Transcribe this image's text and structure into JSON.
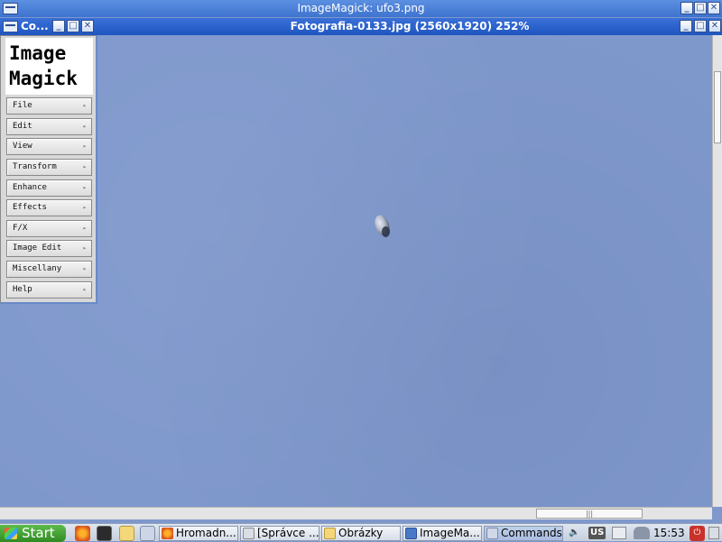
{
  "outer_window": {
    "title": "ImageMagick: ufo3.png",
    "min": "_",
    "max": "□",
    "close": "✕"
  },
  "viewer_window": {
    "title": "Fotografia-0133.jpg (2560x1920) 252%",
    "min": "_",
    "max": "□",
    "close": "✕"
  },
  "commands_window": {
    "title": "Co...",
    "logo_line1": "Image",
    "logo_line2": "Magick",
    "menu": [
      {
        "label": "File"
      },
      {
        "label": "Edit"
      },
      {
        "label": "View"
      },
      {
        "label": "Transform"
      },
      {
        "label": "Enhance"
      },
      {
        "label": "Effects"
      },
      {
        "label": "F/X"
      },
      {
        "label": "Image Edit"
      },
      {
        "label": "Miscellany"
      },
      {
        "label": "Help"
      }
    ],
    "arrow": "▸"
  },
  "taskbar": {
    "start_label": "Start",
    "tasks": [
      {
        "label": "Hromadn..."
      },
      {
        "label": "[Správce ..."
      },
      {
        "label": "Obrázky"
      },
      {
        "label": "ImageMa..."
      },
      {
        "label": "Commands"
      }
    ],
    "keyboard_layout": "US",
    "clock": "15:53"
  }
}
